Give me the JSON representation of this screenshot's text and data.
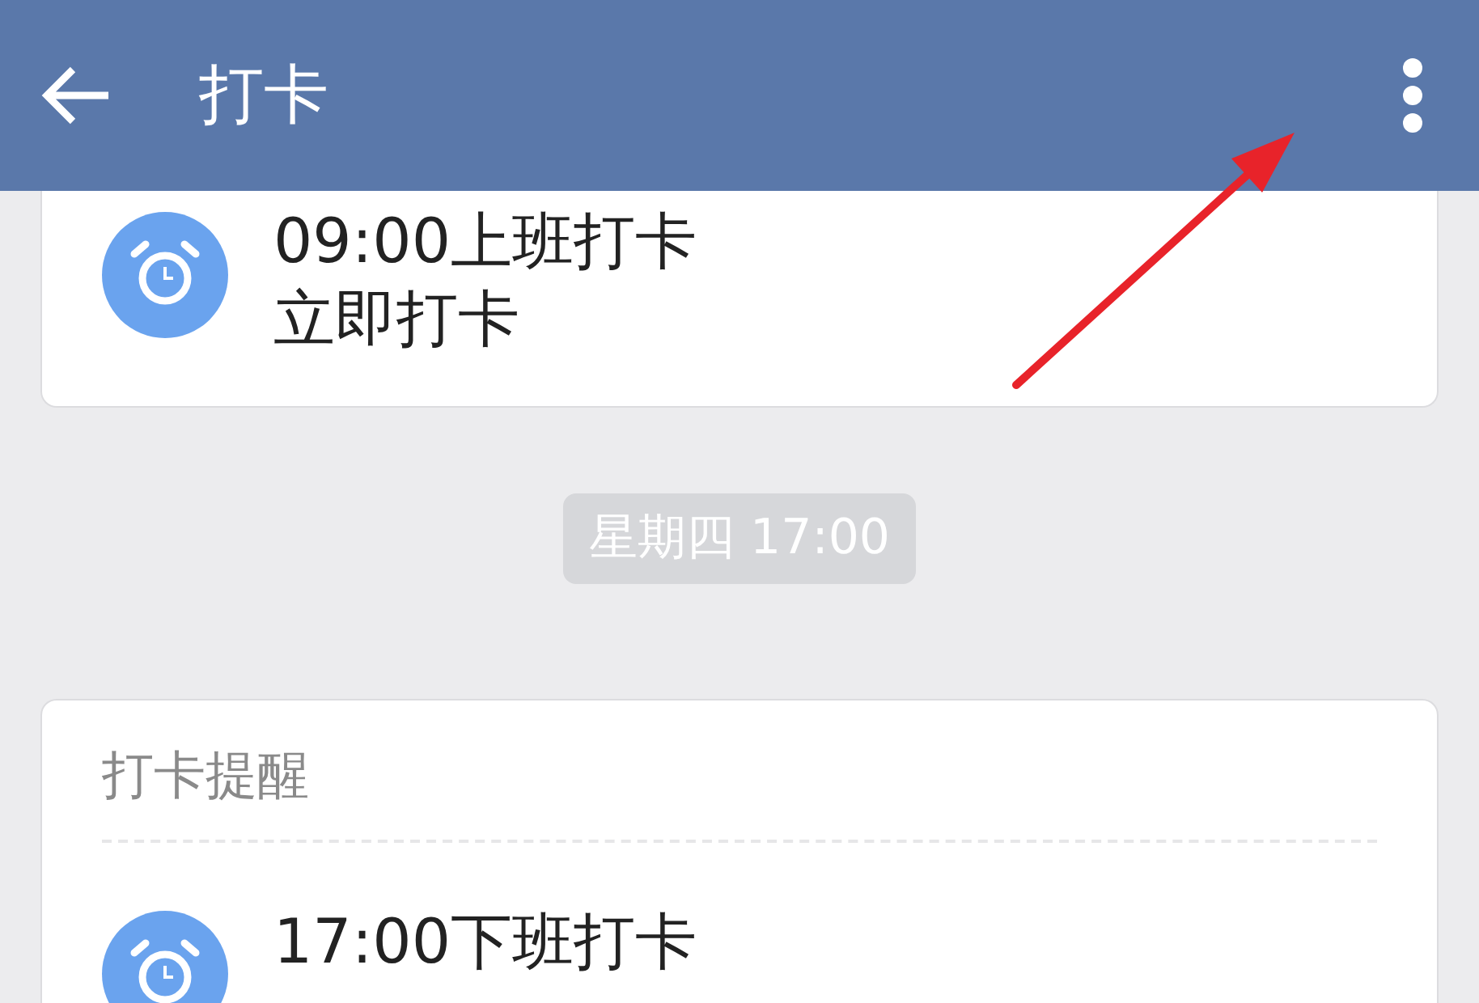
{
  "header": {
    "title": "打卡"
  },
  "first_card": {
    "title": "09:00上班打卡",
    "subtitle": "立即打卡"
  },
  "time_divider": {
    "text": "星期四 17:00"
  },
  "reminder_card": {
    "heading": "打卡提醒",
    "title": "17:00下班打卡"
  }
}
